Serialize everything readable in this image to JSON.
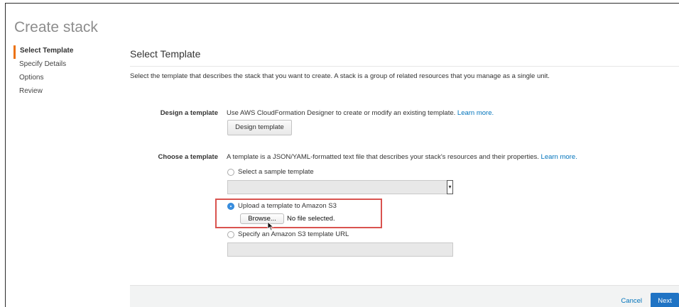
{
  "page": {
    "title": "Create stack"
  },
  "steps": [
    {
      "label": "Select Template",
      "active": true
    },
    {
      "label": "Specify Details",
      "active": false
    },
    {
      "label": "Options",
      "active": false
    },
    {
      "label": "Review",
      "active": false
    }
  ],
  "main": {
    "section_title": "Select Template",
    "description": "Select the template that describes the stack that you want to create. A stack is a group of related resources that you manage as a single unit."
  },
  "design": {
    "label": "Design a template",
    "text": "Use AWS CloudFormation Designer to create or modify an existing template.",
    "learn_more": "Learn more.",
    "button": "Design template"
  },
  "choose": {
    "label": "Choose a template",
    "text": "A template is a JSON/YAML-formatted text file that describes your stack's resources and their properties.",
    "learn_more": "Learn more.",
    "options": {
      "sample": "Select a sample template",
      "upload": "Upload a template to Amazon S3",
      "url": "Specify an Amazon S3 template URL"
    },
    "selected_option": "upload",
    "sample_select_value": "",
    "url_value": "",
    "browse_button": "Browse...",
    "file_status": "No file selected."
  },
  "footer": {
    "cancel": "Cancel",
    "next": "Next"
  },
  "colors": {
    "accent_step": "#ec7211",
    "link": "#0073bb",
    "primary_button": "#1f73c4",
    "highlight_box": "#d9534f"
  }
}
